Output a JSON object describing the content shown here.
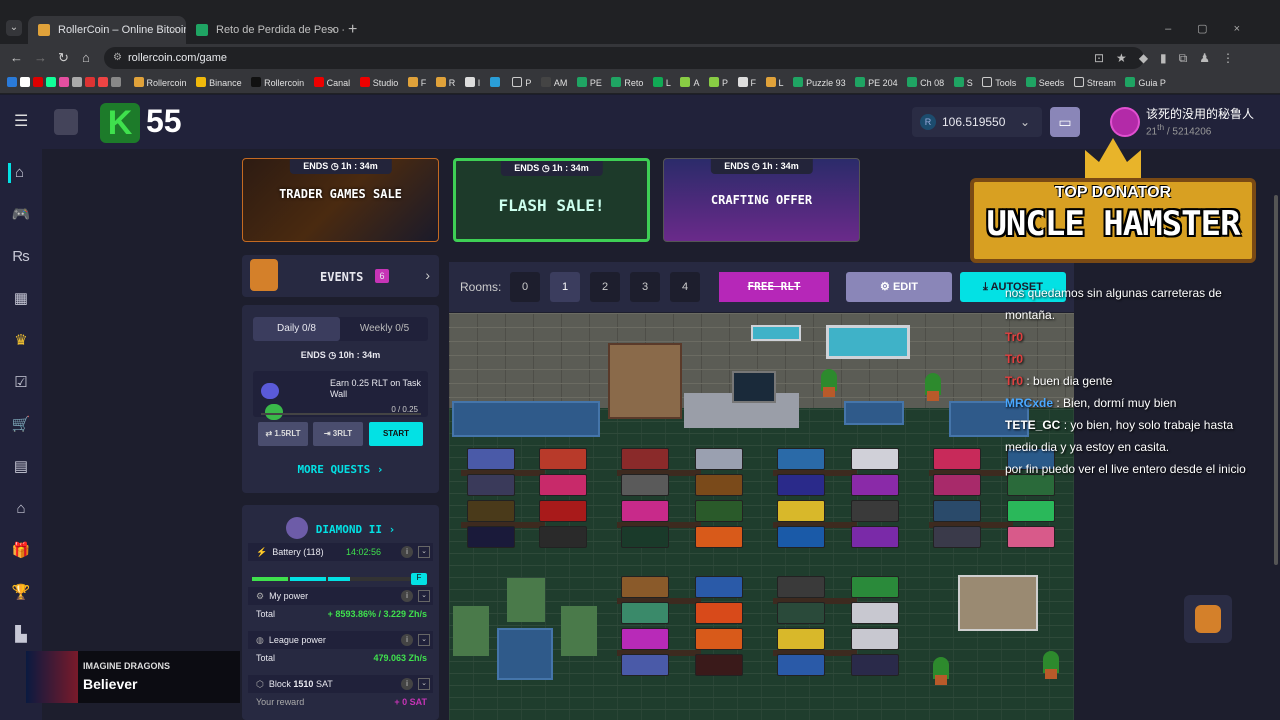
{
  "browser": {
    "tabs": [
      {
        "title": "RollerCoin – Online Bitcoin Min"
      },
      {
        "title": "Reto de Perdida de Peso - El M"
      }
    ],
    "url": "rollercoin.com/game",
    "bookmarks": [
      "Binance",
      "Rollercoin",
      "Canal",
      "Studio",
      "F",
      "R",
      "I",
      "P",
      "AM",
      "PE",
      "Reto",
      "L",
      "A",
      "P",
      "F",
      "L",
      "Puzzle 93",
      "PE 204",
      "Ch 08",
      "S",
      "Tools",
      "Seeds",
      "Stream",
      "Guia P"
    ]
  },
  "topbar": {
    "league_num": "55",
    "balance": "106.519550",
    "currency_symbol": "R",
    "username": "该死的没用的秘鲁人",
    "rank": "21",
    "rank_sup": "th",
    "rank_total": "/ 5214206"
  },
  "banners": [
    {
      "ends_label": "ENDS",
      "time": "1h : 34m",
      "title": "TRADER GAMES SALE"
    },
    {
      "ends_label": "ENDS",
      "time": "1h : 34m",
      "title": "FLASH SALE!"
    },
    {
      "ends_label": "ENDS",
      "time": "1h : 34m",
      "title": "CRAFTING OFFER"
    }
  ],
  "events": {
    "label": "EVENTS",
    "count": "6"
  },
  "quests": {
    "tab_daily": "Daily 0/8",
    "tab_weekly": "Weekly 0/5",
    "ends": "ENDS",
    "ends_time": "10h : 34m",
    "item_text": "Earn 0.25 RLT on Task Wall",
    "item_progress": "0 / 0.25",
    "btn1": "1.5RLT",
    "btn2": "3RLT",
    "btn3": "START",
    "more": "MORE QUESTS"
  },
  "stats": {
    "league": "DIAMOND II",
    "battery_label": "Battery (118)",
    "battery_time": "14:02:56",
    "battery_button": "F",
    "my_power": "My power",
    "total_label": "Total",
    "my_power_total": "+ 8593.86% / 3.229 Zh/s",
    "league_power": "League power",
    "league_power_total": "479.063 Zh/s",
    "block_label": "Block",
    "block_value": "1510",
    "block_unit": "SAT",
    "your_reward": "Your reward",
    "your_reward_value": "+ 0 SAT"
  },
  "room": {
    "rooms_label": "Rooms:",
    "rooms": [
      "0",
      "1",
      "2",
      "3",
      "4"
    ],
    "active_room": "1",
    "free_rlt": "FREE RLT",
    "edit": "EDIT",
    "autoset": "AUTOSET"
  },
  "overlay": {
    "donator_sub": "TOP DONATOR",
    "donator_name": "UNCLE HAMSTER",
    "chat": [
      {
        "name": "",
        "text": "nos quedamos sin algunas carreteras de montaña."
      },
      {
        "name": "Tr0",
        "text": ""
      },
      {
        "name": "Tr0",
        "text": ""
      },
      {
        "name": "Tr0",
        "text": ": buen dia gente"
      },
      {
        "name": "MRCxde",
        "text": ": Bien, dormí muy bien"
      },
      {
        "name": "TETE_GC",
        "text": ": yo bien, hoy solo trabaje hasta medio dia y ya estoy en casita."
      },
      {
        "name": "",
        "text": "por fin puedo ver el live entero desde el inicio"
      }
    ],
    "song_artist": "IMAGINE DRAGONS",
    "song_title": "Believer"
  },
  "colors": {
    "accent": "#03e1e4",
    "power_green": "#3fe14d",
    "pink": "#b627b8"
  }
}
